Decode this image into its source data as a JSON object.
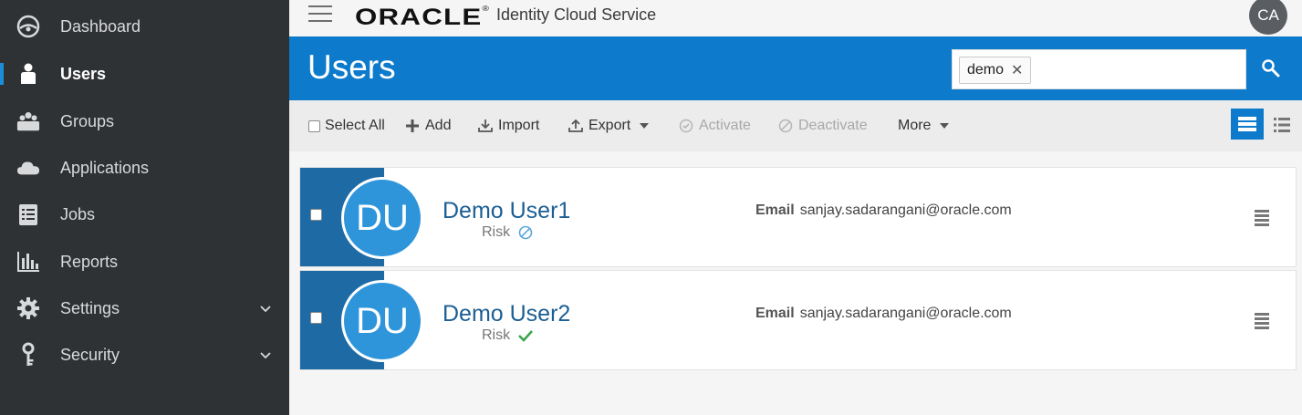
{
  "sidebar": {
    "items": [
      {
        "label": "Dashboard",
        "icon": "dashboard-icon"
      },
      {
        "label": "Users",
        "icon": "user-icon",
        "active": true
      },
      {
        "label": "Groups",
        "icon": "groups-icon"
      },
      {
        "label": "Applications",
        "icon": "cloud-icon"
      },
      {
        "label": "Jobs",
        "icon": "jobs-icon"
      },
      {
        "label": "Reports",
        "icon": "reports-icon"
      },
      {
        "label": "Settings",
        "icon": "gear-icon",
        "expandable": true
      },
      {
        "label": "Security",
        "icon": "key-icon",
        "expandable": true
      }
    ]
  },
  "topbar": {
    "logo": "ORACLE",
    "product": "Identity Cloud Service",
    "user_initials": "CA"
  },
  "header": {
    "title": "Users",
    "search_chip": "demo",
    "search_value": ""
  },
  "toolbar": {
    "select_all": "Select All",
    "add": "Add",
    "import": "Import",
    "export": "Export",
    "activate": "Activate",
    "deactivate": "Deactivate",
    "more": "More"
  },
  "users": [
    {
      "initials": "DU",
      "name": "Demo User1",
      "risk_label": "Risk",
      "risk_status": "disabled",
      "email_label": "Email",
      "email": "sanjay.sadarangani@oracle.com"
    },
    {
      "initials": "DU",
      "name": "Demo User2",
      "risk_label": "Risk",
      "risk_status": "ok",
      "email_label": "Email",
      "email": "sanjay.sadarangani@oracle.com"
    }
  ],
  "colors": {
    "sidebar_bg": "#2f3235",
    "header_blue": "#0d7acb",
    "card_strip": "#1d6aa5",
    "avatar_blue": "#2f95db",
    "risk_ok_green": "#3aa54a"
  }
}
